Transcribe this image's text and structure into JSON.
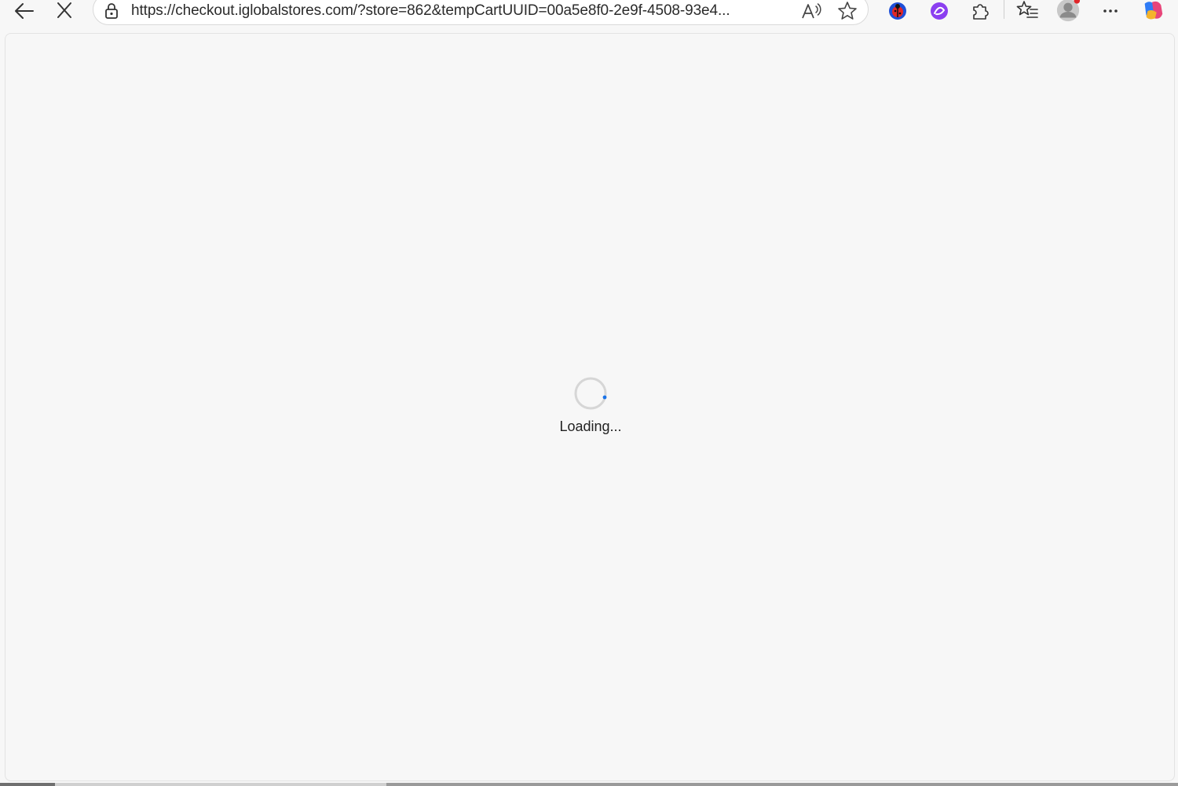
{
  "browser": {
    "address_bar": {
      "url": "https://checkout.iglobalstores.com/?store=862&tempCartUUID=00a5e8f0-2e9f-4508-93e4..."
    },
    "icons": {
      "back": "back-arrow-icon",
      "stop": "stop-loading-icon",
      "lock": "lock-icon",
      "read_aloud": "read-aloud-icon",
      "favorite": "favorite-star-icon",
      "extension_1": "ladybug-extension-icon",
      "extension_2": "purple-extension-icon",
      "extensions": "extensions-puzzle-icon",
      "favorites": "favorites-list-icon",
      "profile": "profile-avatar-icon",
      "more": "more-options-icon",
      "copilot": "copilot-icon"
    },
    "colors": {
      "toolbar_bg": "#f7f7f7",
      "page_bg": "#f7f7f7",
      "spinner_track": "#d6d6d6",
      "spinner_accent": "#1a73e8",
      "profile_badge": "#e0262a"
    }
  },
  "page": {
    "loading_text": "Loading..."
  }
}
